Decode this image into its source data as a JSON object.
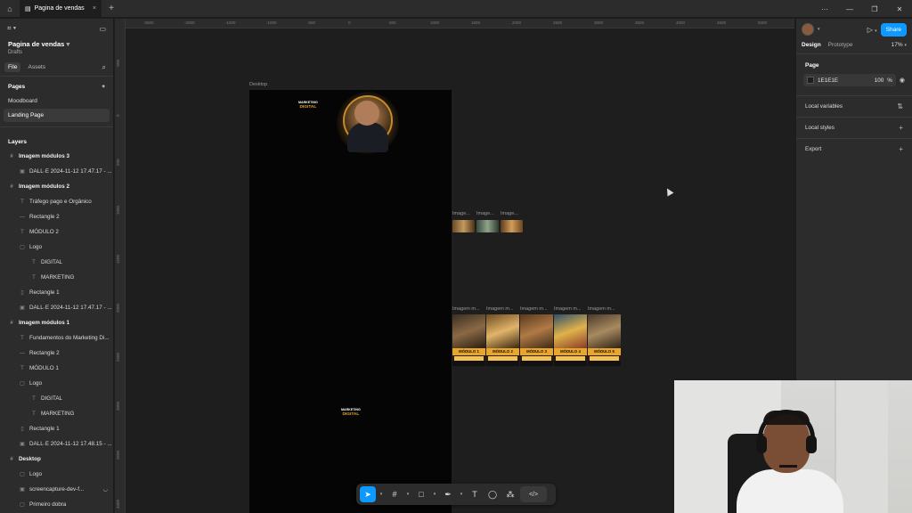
{
  "tabbar": {
    "tab_title": "Pagina de vendas",
    "home_icon": "home-icon",
    "close_icon": "close-icon",
    "new_tab_icon": "plus-icon"
  },
  "left_panel": {
    "file_name": "Pagina de vendas",
    "location": "Drafts",
    "tabs": [
      "File",
      "Assets"
    ],
    "pages_title": "Pages",
    "pages": [
      "Moodboard",
      "Landing Page"
    ],
    "active_page": "Landing Page",
    "layers_title": "Layers",
    "layers": [
      {
        "label": "Imagem módulos 3",
        "level": 0,
        "icon": "#"
      },
      {
        "label": "DALL·E 2024-11-12 17.47.17 - ...",
        "level": 1,
        "icon": "▣"
      },
      {
        "label": "Imagem módulos 2",
        "level": 0,
        "icon": "#"
      },
      {
        "label": "Tráfego pago e Orgânico",
        "level": 1,
        "icon": "T"
      },
      {
        "label": "Rectangle 2",
        "level": 1,
        "icon": "—"
      },
      {
        "label": "MÓDULO 2",
        "level": 1,
        "icon": "T"
      },
      {
        "label": "Logo",
        "level": 1,
        "icon": "▢"
      },
      {
        "label": "DIGITAL",
        "level": 2,
        "icon": "T"
      },
      {
        "label": "MARKETING",
        "level": 2,
        "icon": "T"
      },
      {
        "label": "Rectangle 1",
        "level": 1,
        "icon": "▯"
      },
      {
        "label": "DALL·E 2024-11-12 17.47.17 - ...",
        "level": 1,
        "icon": "▣"
      },
      {
        "label": "Imagem módulos 1",
        "level": 0,
        "icon": "#"
      },
      {
        "label": "Fundamentos do Marketing Di...",
        "level": 1,
        "icon": "T"
      },
      {
        "label": "Rectangle 2",
        "level": 1,
        "icon": "—"
      },
      {
        "label": "MÓDULO 1",
        "level": 1,
        "icon": "T"
      },
      {
        "label": "Logo",
        "level": 1,
        "icon": "▢"
      },
      {
        "label": "DIGITAL",
        "level": 2,
        "icon": "T"
      },
      {
        "label": "MARKETING",
        "level": 2,
        "icon": "T"
      },
      {
        "label": "Rectangle 1",
        "level": 1,
        "icon": "▯"
      },
      {
        "label": "DALL·E 2024-11-12 17.48.15 - ...",
        "level": 1,
        "icon": "▣"
      },
      {
        "label": "Desktop",
        "level": 0,
        "icon": "#"
      },
      {
        "label": "Logo",
        "level": 1,
        "icon": "▢"
      },
      {
        "label": "screencapture-dev-f...",
        "level": 1,
        "icon": "▣"
      },
      {
        "label": "Primeiro dobra",
        "level": 1,
        "icon": "▢"
      }
    ]
  },
  "canvas": {
    "ruler_top": [
      "-2500",
      "-2000",
      "-1500",
      "-1000",
      "-500",
      "0",
      "500",
      "1000",
      "1500",
      "2000",
      "2500",
      "3000",
      "3500",
      "4000",
      "4500",
      "5000"
    ],
    "ruler_left": [
      "-500",
      "0",
      "500",
      "1000",
      "1500",
      "2000",
      "2500",
      "3000",
      "3500",
      "4000"
    ],
    "desktop_label": "Desktop",
    "logo_top": "MARKETING",
    "logo_bottom": "DIGITAL",
    "thumb_labels": [
      "Image...",
      "Image...",
      "Image..."
    ],
    "module_labels_top": [
      "Imagem m...",
      "Imagem m...",
      "Imagem m...",
      "Imagem m...",
      "Imagem m..."
    ],
    "modules": [
      "MÓDULO 1",
      "MÓDULO 2",
      "MÓDULO 3",
      "MÓDULO 4",
      "MÓDULO 5"
    ]
  },
  "toolbar": {
    "tools": [
      "move-tool",
      "frame-tool",
      "shape-tool",
      "pen-tool",
      "text-tool",
      "comment-tool",
      "actions-tool",
      "dev-mode-toggle"
    ]
  },
  "right_panel": {
    "share_label": "Share",
    "tabs": [
      "Design",
      "Prototype"
    ],
    "active_tab": "Design",
    "zoom": "17%",
    "page_section": "Page",
    "page_color": "1E1E1E",
    "page_opacity": "100",
    "opacity_unit": "%",
    "rows": [
      "Local variables",
      "Local styles",
      "Export"
    ]
  },
  "colors": {
    "accent": "#0d99ff",
    "canvas_bg": "#1e1e1e",
    "panel_bg": "#2c2c2c",
    "gold": "#e9a62b"
  }
}
